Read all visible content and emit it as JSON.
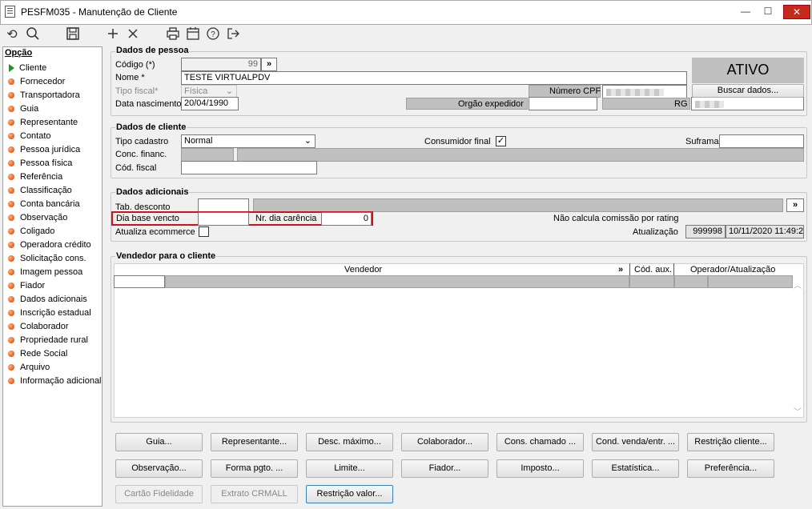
{
  "window": {
    "title": "PESFM035 - Manutenção de Cliente",
    "minimize": "—",
    "maximize": "☐",
    "close": "✕"
  },
  "toolbar": {
    "icons": [
      "undo-icon",
      "search-icon",
      "save-icon",
      "add-icon",
      "delete-icon",
      "print-icon",
      "calendar-icon",
      "help-icon",
      "exit-icon"
    ]
  },
  "sidebar": {
    "title": "Opção",
    "items": [
      "Cliente",
      "Fornecedor",
      "Transportadora",
      "Guia",
      "Representante",
      "Contato",
      "Pessoa jurídica",
      "Pessoa física",
      "Referência",
      "Classificação",
      "Conta bancária",
      "Observação",
      "Coligado",
      "Operadora crédito",
      "Solicitação cons.",
      "Imagem pessoa",
      "Fiador",
      "Dados adicionais",
      "Inscrição estadual",
      "Colaborador",
      "Propriedade rural",
      "Rede Social",
      "Arquivo",
      "Informação adicional"
    ]
  },
  "pessoa": {
    "section": "Dados de pessoa",
    "codigo_label": "Código (*)",
    "codigo_value": "99",
    "more": "»",
    "nome_label": "Nome *",
    "nome_value": "TESTE VIRTUALPDV",
    "tipo_fiscal_label": "Tipo fiscal*",
    "tipo_fiscal_value": "Física",
    "cpf_label": "Número CPF",
    "nasc_label": "Data nascimento",
    "nasc_value": "20/04/1990",
    "orgao_label": "Orgão expedidor",
    "rg_label": "RG",
    "status": "ATIVO",
    "buscar": "Buscar dados..."
  },
  "cliente": {
    "section": "Dados de cliente",
    "tipo_cadastro_label": "Tipo cadastro",
    "tipo_cadastro_value": "Normal",
    "consumidor_label": "Consumidor final",
    "consumidor_checked": "✓",
    "suframa_label": "Suframa",
    "conc_label": "Conc. financ.",
    "cod_fiscal_label": "Cód. fiscal"
  },
  "adicionais": {
    "section": "Dados adicionais",
    "tab_desconto_label": "Tab. desconto",
    "more": "»",
    "dia_base_label": "Dia base vencto",
    "nr_dia_label": "Nr. dia carência",
    "nr_dia_value": "0",
    "nao_calcula": "Não calcula comissão por rating",
    "atualiza_label": "Atualiza ecommerce",
    "atualizacao_label": "Atualização",
    "atualizacao_user": "999998",
    "atualizacao_date": "10/11/2020 11:49:24"
  },
  "vendedor": {
    "section": "Vendedor para o cliente",
    "col_vendedor": "Vendedor",
    "col_more": "»",
    "col_cod": "Cód. aux.",
    "col_operador": "Operador/Atualização"
  },
  "buttons": {
    "row1": [
      "Guia...",
      "Representante...",
      "Desc. máximo...",
      "Colaborador...",
      "Cons. chamado ...",
      "Cond. venda/entr. ...",
      "Restrição cliente..."
    ],
    "row2": [
      "Observação...",
      "Forma pgto. ...",
      "Limite...",
      "Fiador...",
      "Imposto...",
      "Estatística...",
      "Preferência..."
    ],
    "row3": [
      "Cartão Fidelidade",
      "Extrato CRMALL",
      "Restrição valor..."
    ]
  },
  "colors": {
    "highlight": "#d0101c",
    "status_bg": "#c0c0c0"
  }
}
